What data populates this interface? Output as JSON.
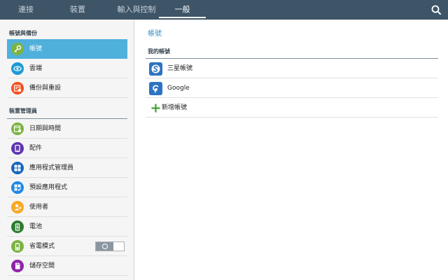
{
  "topbar": {
    "tabs": [
      {
        "label": "連接",
        "active": false
      },
      {
        "label": "裝置",
        "active": false
      },
      {
        "label": "輸入與控制",
        "active": false
      },
      {
        "label": "一般",
        "active": true
      }
    ],
    "search_icon": "search-icon"
  },
  "sidebar": {
    "sections": [
      {
        "header": "帳號與備份",
        "items": [
          {
            "label": "帳號",
            "icon": "key-icon",
            "color": "#7cb342",
            "selected": true
          },
          {
            "label": "雲端",
            "icon": "eye-icon",
            "color": "#1e9ad6",
            "selected": false
          },
          {
            "label": "備份與重設",
            "icon": "backup-icon",
            "color": "#f4511e",
            "selected": false
          }
        ]
      },
      {
        "header": "裝置管理員",
        "items": [
          {
            "label": "日期與時間",
            "icon": "calendar-icon",
            "color": "#7cb342"
          },
          {
            "label": "配件",
            "icon": "accessory-icon",
            "color": "#5e35b1"
          },
          {
            "label": "應用程式管理員",
            "icon": "grid-icon",
            "color": "#1565c0"
          },
          {
            "label": "預設應用程式",
            "icon": "default-app-icon",
            "color": "#1e88e5"
          },
          {
            "label": "使用者",
            "icon": "user-icon",
            "color": "#f9a825"
          },
          {
            "label": "電池",
            "icon": "battery-icon",
            "color": "#2e7d32"
          },
          {
            "label": "省電模式",
            "icon": "power-saving-icon",
            "color": "#7cb342",
            "toggle_on": false
          },
          {
            "label": "儲存空間",
            "icon": "storage-icon",
            "color": "#8e24aa"
          }
        ]
      }
    ]
  },
  "main": {
    "title": "帳號",
    "section_header": "我的帳號",
    "accounts": [
      {
        "label": "三星帳號",
        "icon": "samsung-account-icon",
        "color": "#2d73c2"
      },
      {
        "label": "Google",
        "icon": "google-icon",
        "color": "#2d73c2"
      },
      {
        "label": "新增帳號",
        "icon": "plus-icon",
        "color": "#3ea22a"
      }
    ]
  }
}
